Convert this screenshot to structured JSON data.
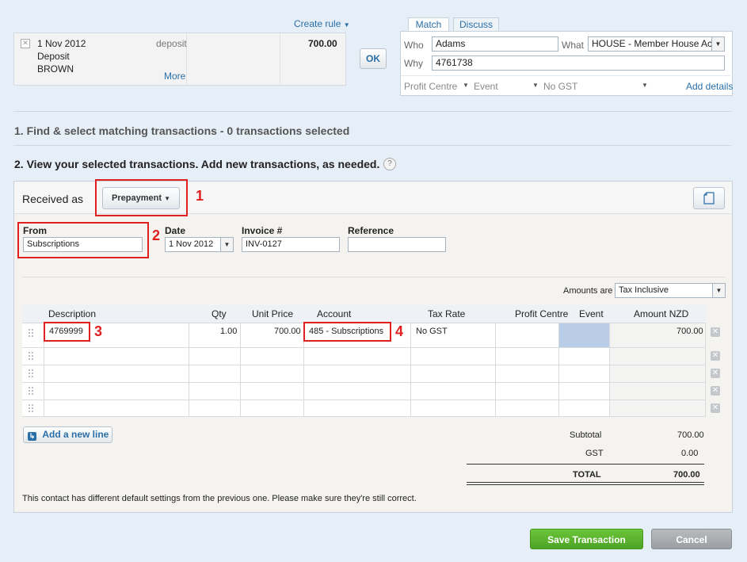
{
  "top": {
    "create_rule": "Create rule",
    "statement": {
      "date": "1 Nov 2012",
      "type": "deposit",
      "desc1": "Deposit",
      "desc2": "BROWN",
      "more": "More",
      "amount": "700.00"
    },
    "ok_label": "OK"
  },
  "match_panel": {
    "tabs": [
      "Match",
      "Discuss"
    ],
    "who_label": "Who",
    "who_value": "Adams",
    "what_label": "What",
    "what_value": "HOUSE - Member House Acco",
    "why_label": "Why",
    "why_value": "4761738",
    "profit_centre": "Profit Centre",
    "event": "Event",
    "gst": "No GST",
    "add_details": "Add details"
  },
  "steps": {
    "step1": "1. Find & select matching transactions - 0 transactions selected",
    "step2": "2. View your selected transactions. Add new transactions, as needed."
  },
  "form": {
    "received_as": "Received as",
    "received_type": "Prepayment",
    "from_label": "From",
    "from_value": "Subscriptions",
    "date_label": "Date",
    "date_value": "1 Nov 2012",
    "invoice_label": "Invoice #",
    "invoice_value": "INV-0127",
    "reference_label": "Reference",
    "reference_value": "",
    "amounts_are_label": "Amounts are",
    "amounts_are_value": "Tax Inclusive"
  },
  "grid": {
    "headers": {
      "description": "Description",
      "qty": "Qty",
      "unit_price": "Unit Price",
      "account": "Account",
      "tax_rate": "Tax Rate",
      "profit_centre": "Profit Centre",
      "event": "Event",
      "amount": "Amount NZD"
    },
    "rows": [
      {
        "description": "4769999",
        "qty": "1.00",
        "unit_price": "700.00",
        "account": "485 - Subscriptions",
        "tax_rate": "No GST",
        "amount": "700.00"
      }
    ],
    "add_line": "Add a new line"
  },
  "totals": {
    "subtotal_label": "Subtotal",
    "subtotal": "700.00",
    "gst_label": "GST",
    "gst": "0.00",
    "total_label": "TOTAL",
    "total": "700.00"
  },
  "notice": "This contact has different default settings from the previous one. Please make sure they're still correct.",
  "annotations": [
    "1",
    "2",
    "3",
    "4"
  ],
  "buttons": {
    "save": "Save Transaction",
    "cancel": "Cancel"
  },
  "colors": {
    "annotation_red": "#e0201e",
    "save_green": "#5cb030",
    "link_blue": "#2a6fa8"
  }
}
